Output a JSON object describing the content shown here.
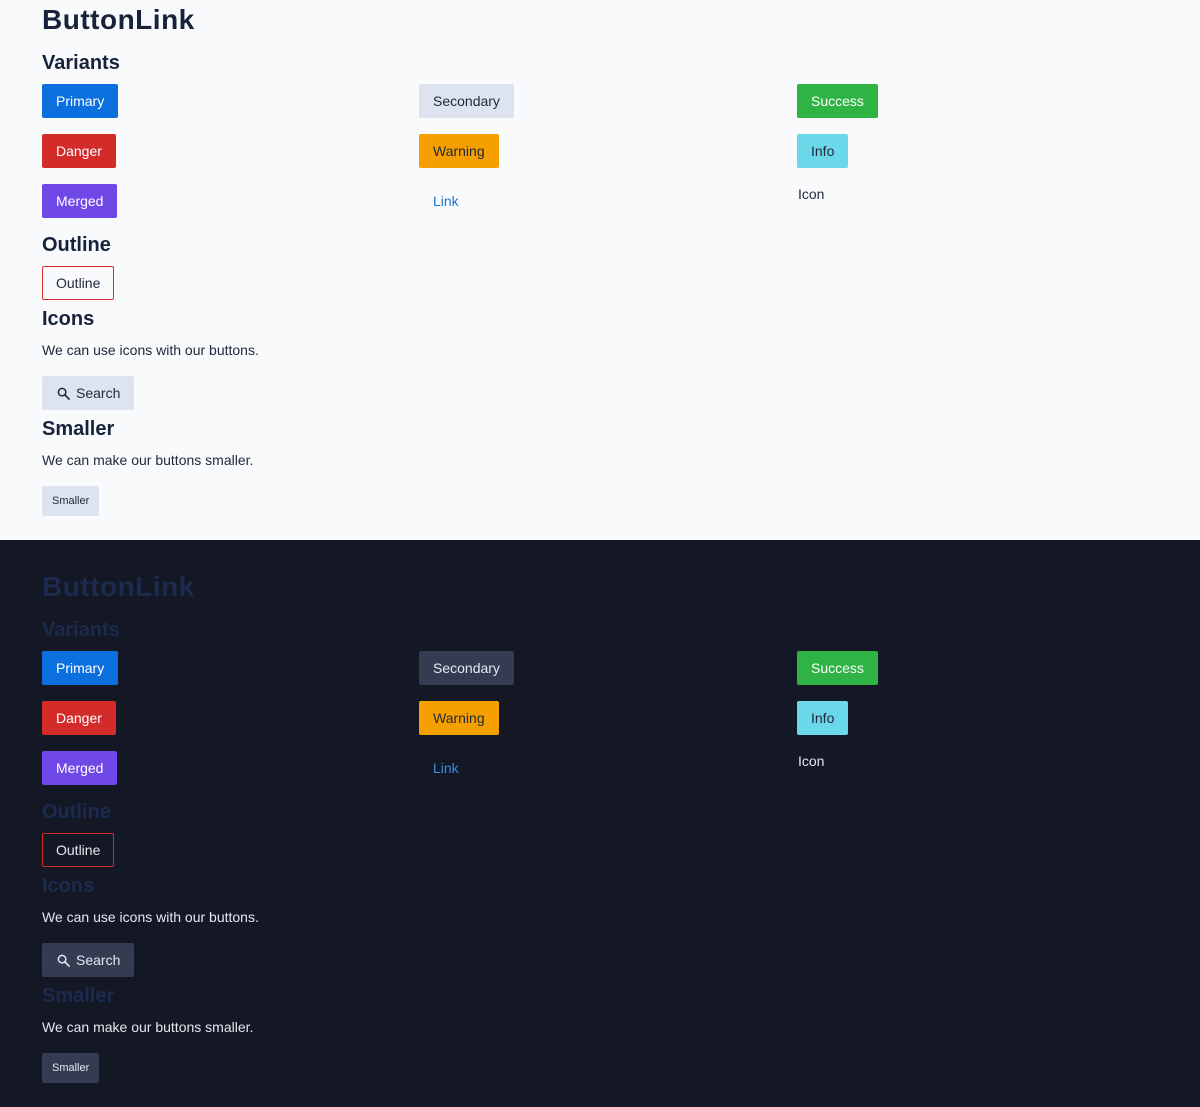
{
  "themes": [
    {
      "name": "light",
      "title": "ButtonLink",
      "sections": {
        "variants": "Variants",
        "outline": "Outline",
        "icons": "Icons",
        "smaller": "Smaller"
      },
      "buttons": {
        "primary": "Primary",
        "secondary": "Secondary",
        "success": "Success",
        "danger": "Danger",
        "warning": "Warning",
        "info": "Info",
        "merged": "Merged",
        "link": "Link",
        "icon": "Icon",
        "outline": "Outline",
        "search": "Search",
        "smaller": "Smaller"
      },
      "descriptions": {
        "icons": "We can use icons with our buttons.",
        "smaller": "We can make our buttons smaller."
      }
    },
    {
      "name": "dark",
      "title": "ButtonLink",
      "sections": {
        "variants": "Variants",
        "outline": "Outline",
        "icons": "Icons",
        "smaller": "Smaller"
      },
      "buttons": {
        "primary": "Primary",
        "secondary": "Secondary",
        "success": "Success",
        "danger": "Danger",
        "warning": "Warning",
        "info": "Info",
        "merged": "Merged",
        "link": "Link",
        "icon": "Icon",
        "outline": "Outline",
        "search": "Search",
        "smaller": "Smaller"
      },
      "descriptions": {
        "icons": "We can use icons with our buttons.",
        "smaller": "We can make our buttons smaller."
      }
    }
  ],
  "icons": {
    "search": "search-icon"
  },
  "colors": {
    "primary": "#0b6fdd",
    "success": "#2fb344",
    "danger": "#d32a2a",
    "warning": "#f59f00",
    "info": "#6ad8e8",
    "merged": "#7048e8",
    "light_bg": "#f8fafc",
    "dark_bg": "#141824"
  }
}
